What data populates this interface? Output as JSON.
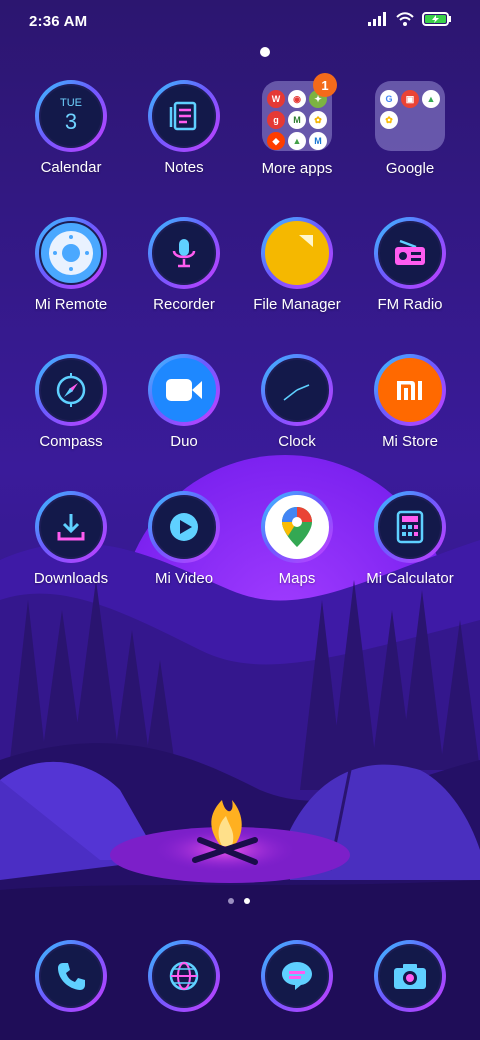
{
  "status_bar": {
    "time": "2:36 AM",
    "icons": [
      "signal-icon",
      "wifi-icon",
      "battery-charging-icon"
    ]
  },
  "home": {
    "page_indicator_top": "home-page-dot",
    "apps": [
      {
        "label": "Calendar",
        "icon": "calendar-icon",
        "day_name": "TUE",
        "day_number": "3"
      },
      {
        "label": "Notes",
        "icon": "notes-icon"
      },
      {
        "label": "More apps",
        "icon": "folder-icon",
        "badge": "1"
      },
      {
        "label": "Google",
        "icon": "folder-icon"
      },
      {
        "label": "Mi Remote",
        "icon": "remote-icon"
      },
      {
        "label": "Recorder",
        "icon": "microphone-icon"
      },
      {
        "label": "File Manager",
        "icon": "folder-file-icon"
      },
      {
        "label": "FM Radio",
        "icon": "radio-icon"
      },
      {
        "label": "Compass",
        "icon": "compass-icon"
      },
      {
        "label": "Duo",
        "icon": "video-camera-icon"
      },
      {
        "label": "Clock",
        "icon": "clock-icon"
      },
      {
        "label": "Mi Store",
        "icon": "mi-logo-icon",
        "logo_text": "mi"
      },
      {
        "label": "Downloads",
        "icon": "download-icon"
      },
      {
        "label": "Mi Video",
        "icon": "play-icon"
      },
      {
        "label": "Maps",
        "icon": "map-pin-icon"
      },
      {
        "label": "Mi Calculator",
        "icon": "calculator-icon"
      }
    ],
    "folder_more_apps": [
      {
        "letter": "W",
        "color": "#e53935"
      },
      {
        "letter": "",
        "color": "#1e88e5"
      },
      {
        "letter": "",
        "color": "#7cb342"
      },
      {
        "letter": "g",
        "color": "#e53935"
      },
      {
        "letter": "M",
        "color": "#4caf50"
      },
      {
        "letter": "",
        "color": "#f4b400"
      },
      {
        "letter": "",
        "color": "#ff3d00"
      },
      {
        "letter": "",
        "color": "#43a047"
      },
      {
        "letter": "M",
        "color": "#1976d2"
      }
    ],
    "folder_google": [
      {
        "letter": "G",
        "color": "#ffffff"
      },
      {
        "letter": "",
        "color": "#ea4335"
      },
      {
        "letter": "",
        "color": "#34a853"
      },
      {
        "letter": "",
        "color": "#fbbc05"
      }
    ],
    "pages": {
      "count": 2,
      "active": 2
    }
  },
  "dock": [
    {
      "name": "phone",
      "icon": "phone-icon"
    },
    {
      "name": "browser",
      "icon": "globe-icon"
    },
    {
      "name": "messages",
      "icon": "message-icon"
    },
    {
      "name": "camera",
      "icon": "camera-icon"
    }
  ],
  "colors": {
    "accent_ring_start": "#37c9ff",
    "accent_ring_end": "#c93cff",
    "badge": "#f46a1a",
    "mi_store": "#ff6900",
    "file_manager": "#f5b800"
  }
}
